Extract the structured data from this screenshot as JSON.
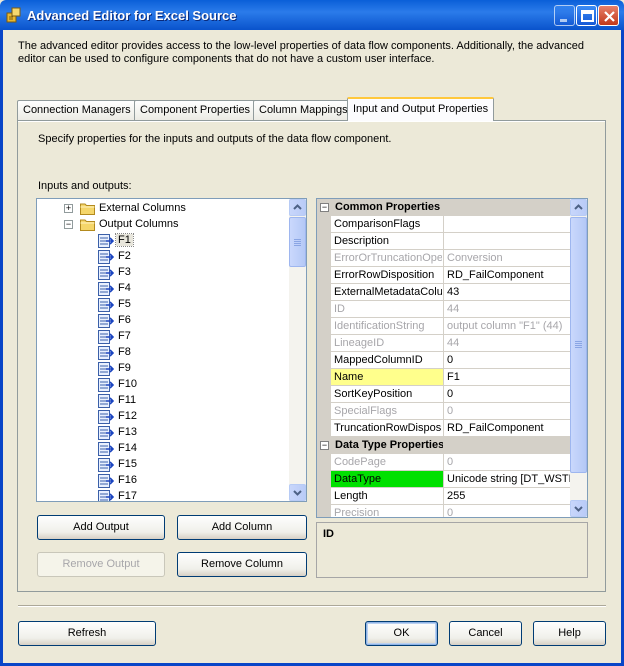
{
  "window": {
    "title": "Advanced Editor for Excel Source",
    "description": "The advanced editor provides access to the low-level properties of data flow components. Additionally, the advanced editor can be used to configure components that do not have a custom user interface."
  },
  "tabs": [
    {
      "label": "Connection Managers",
      "active": false
    },
    {
      "label": "Component Properties",
      "active": false
    },
    {
      "label": "Column Mappings",
      "active": false
    },
    {
      "label": "Input and Output Properties",
      "active": true
    }
  ],
  "panel": {
    "specify_text": "Specify properties for the inputs and outputs of the data flow component.",
    "io_label": "Inputs and outputs:"
  },
  "tree": {
    "external_columns": "External Columns",
    "output_columns": "Output Columns",
    "columns": [
      "F1",
      "F2",
      "F3",
      "F4",
      "F5",
      "F6",
      "F7",
      "F8",
      "F9",
      "F10",
      "F11",
      "F12",
      "F13",
      "F14",
      "F15",
      "F16",
      "F17"
    ],
    "selected": "F1"
  },
  "properties": {
    "common_header": "Common Properties",
    "common": [
      {
        "name": "ComparisonFlags",
        "value": "",
        "disabled": false
      },
      {
        "name": "Description",
        "value": "",
        "disabled": false
      },
      {
        "name": "ErrorOrTruncationOpe",
        "value": "Conversion",
        "disabled": true
      },
      {
        "name": "ErrorRowDisposition",
        "value": "RD_FailComponent",
        "disabled": false
      },
      {
        "name": "ExternalMetadataColu",
        "value": "43",
        "disabled": false
      },
      {
        "name": "ID",
        "value": "44",
        "disabled": true
      },
      {
        "name": "IdentificationString",
        "value": "output column \"F1\" (44)",
        "disabled": true
      },
      {
        "name": "LineageID",
        "value": "44",
        "disabled": true
      },
      {
        "name": "MappedColumnID",
        "value": "0",
        "disabled": false
      },
      {
        "name": "Name",
        "value": "F1",
        "disabled": false,
        "highlight": "#ffff8c"
      },
      {
        "name": "SortKeyPosition",
        "value": "0",
        "disabled": false
      },
      {
        "name": "SpecialFlags",
        "value": "0",
        "disabled": true
      },
      {
        "name": "TruncationRowDisposi",
        "value": "RD_FailComponent",
        "disabled": false
      }
    ],
    "datatype_header": "Data Type Properties",
    "datatype": [
      {
        "name": "CodePage",
        "value": "0",
        "disabled": true
      },
      {
        "name": "DataType",
        "value": "Unicode string [DT_WSTR",
        "disabled": false,
        "highlight": "#00e000"
      },
      {
        "name": "Length",
        "value": "255",
        "disabled": false
      },
      {
        "name": "Precision",
        "value": "0",
        "disabled": true
      }
    ]
  },
  "description_panel": {
    "title": "ID"
  },
  "buttons": {
    "add_output": "Add Output",
    "add_column": "Add Column",
    "remove_output": "Remove Output",
    "remove_column": "Remove Column",
    "refresh": "Refresh",
    "ok": "OK",
    "cancel": "Cancel",
    "help": "Help"
  },
  "colors": {
    "titlebar": "#0a5fd8",
    "name_highlight": "#ffff8c",
    "datatype_highlight": "#00e000"
  }
}
